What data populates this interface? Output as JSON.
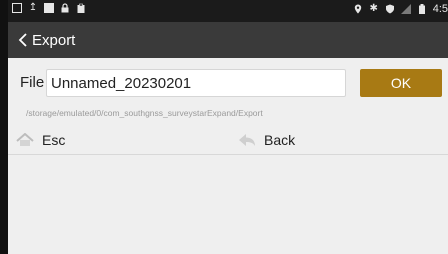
{
  "status_bar": {
    "time": "4:5",
    "icons": [
      "image-icon",
      "upload-icon",
      "square-icon",
      "lock-icon",
      "clipboard-icon",
      "location-icon",
      "bluetooth-icon",
      "shield-icon",
      "signal-icon",
      "battery-icon"
    ]
  },
  "header": {
    "title": "Export"
  },
  "file": {
    "label": "File",
    "value": "Unnamed_20230201",
    "ok_label": "OK"
  },
  "path": "/storage/emulated/0/com_southgnss_surveystarExpand/Export",
  "actions": {
    "esc_label": "Esc",
    "back_label": "Back"
  },
  "colors": {
    "status_bar_bg": "#1b1b1b",
    "title_bar_bg": "#3a3a3a",
    "accent": "#a87a14",
    "content_bg": "#efefef"
  }
}
